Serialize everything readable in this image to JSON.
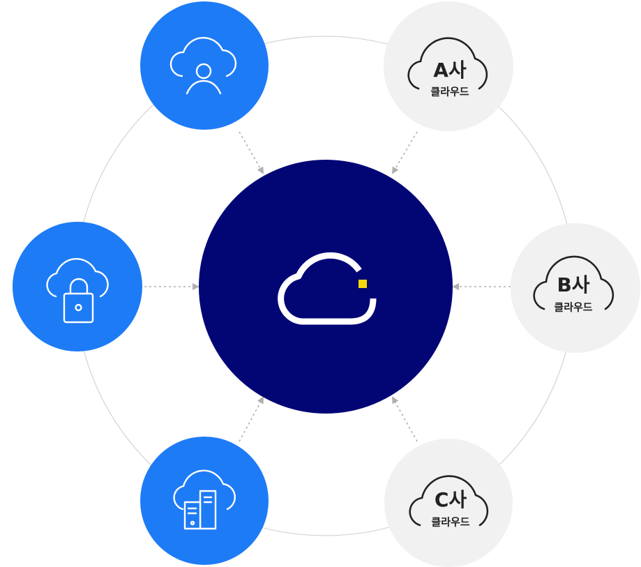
{
  "colors": {
    "center": "#020675",
    "service_node": "#1e7bf6",
    "vendor_node": "#f1f1f1",
    "accent_square": "#f5d90a",
    "ring": "#d4d4d4",
    "arrow": "#b0b0b0",
    "icon_stroke_light": "#ffffff",
    "vendor_text": "#222222"
  },
  "center_node": {
    "icon": "cloud-icon"
  },
  "service_nodes": [
    {
      "icon": "cloud-user-icon"
    },
    {
      "icon": "cloud-lock-icon"
    },
    {
      "icon": "cloud-server-icon"
    }
  ],
  "vendor_nodes": [
    {
      "name": "A사",
      "sub": "클라우드",
      "icon": "cloud-outline-icon"
    },
    {
      "name": "B사",
      "sub": "클라우드",
      "icon": "cloud-outline-icon"
    },
    {
      "name": "C사",
      "sub": "클라우드",
      "icon": "cloud-outline-icon"
    }
  ]
}
